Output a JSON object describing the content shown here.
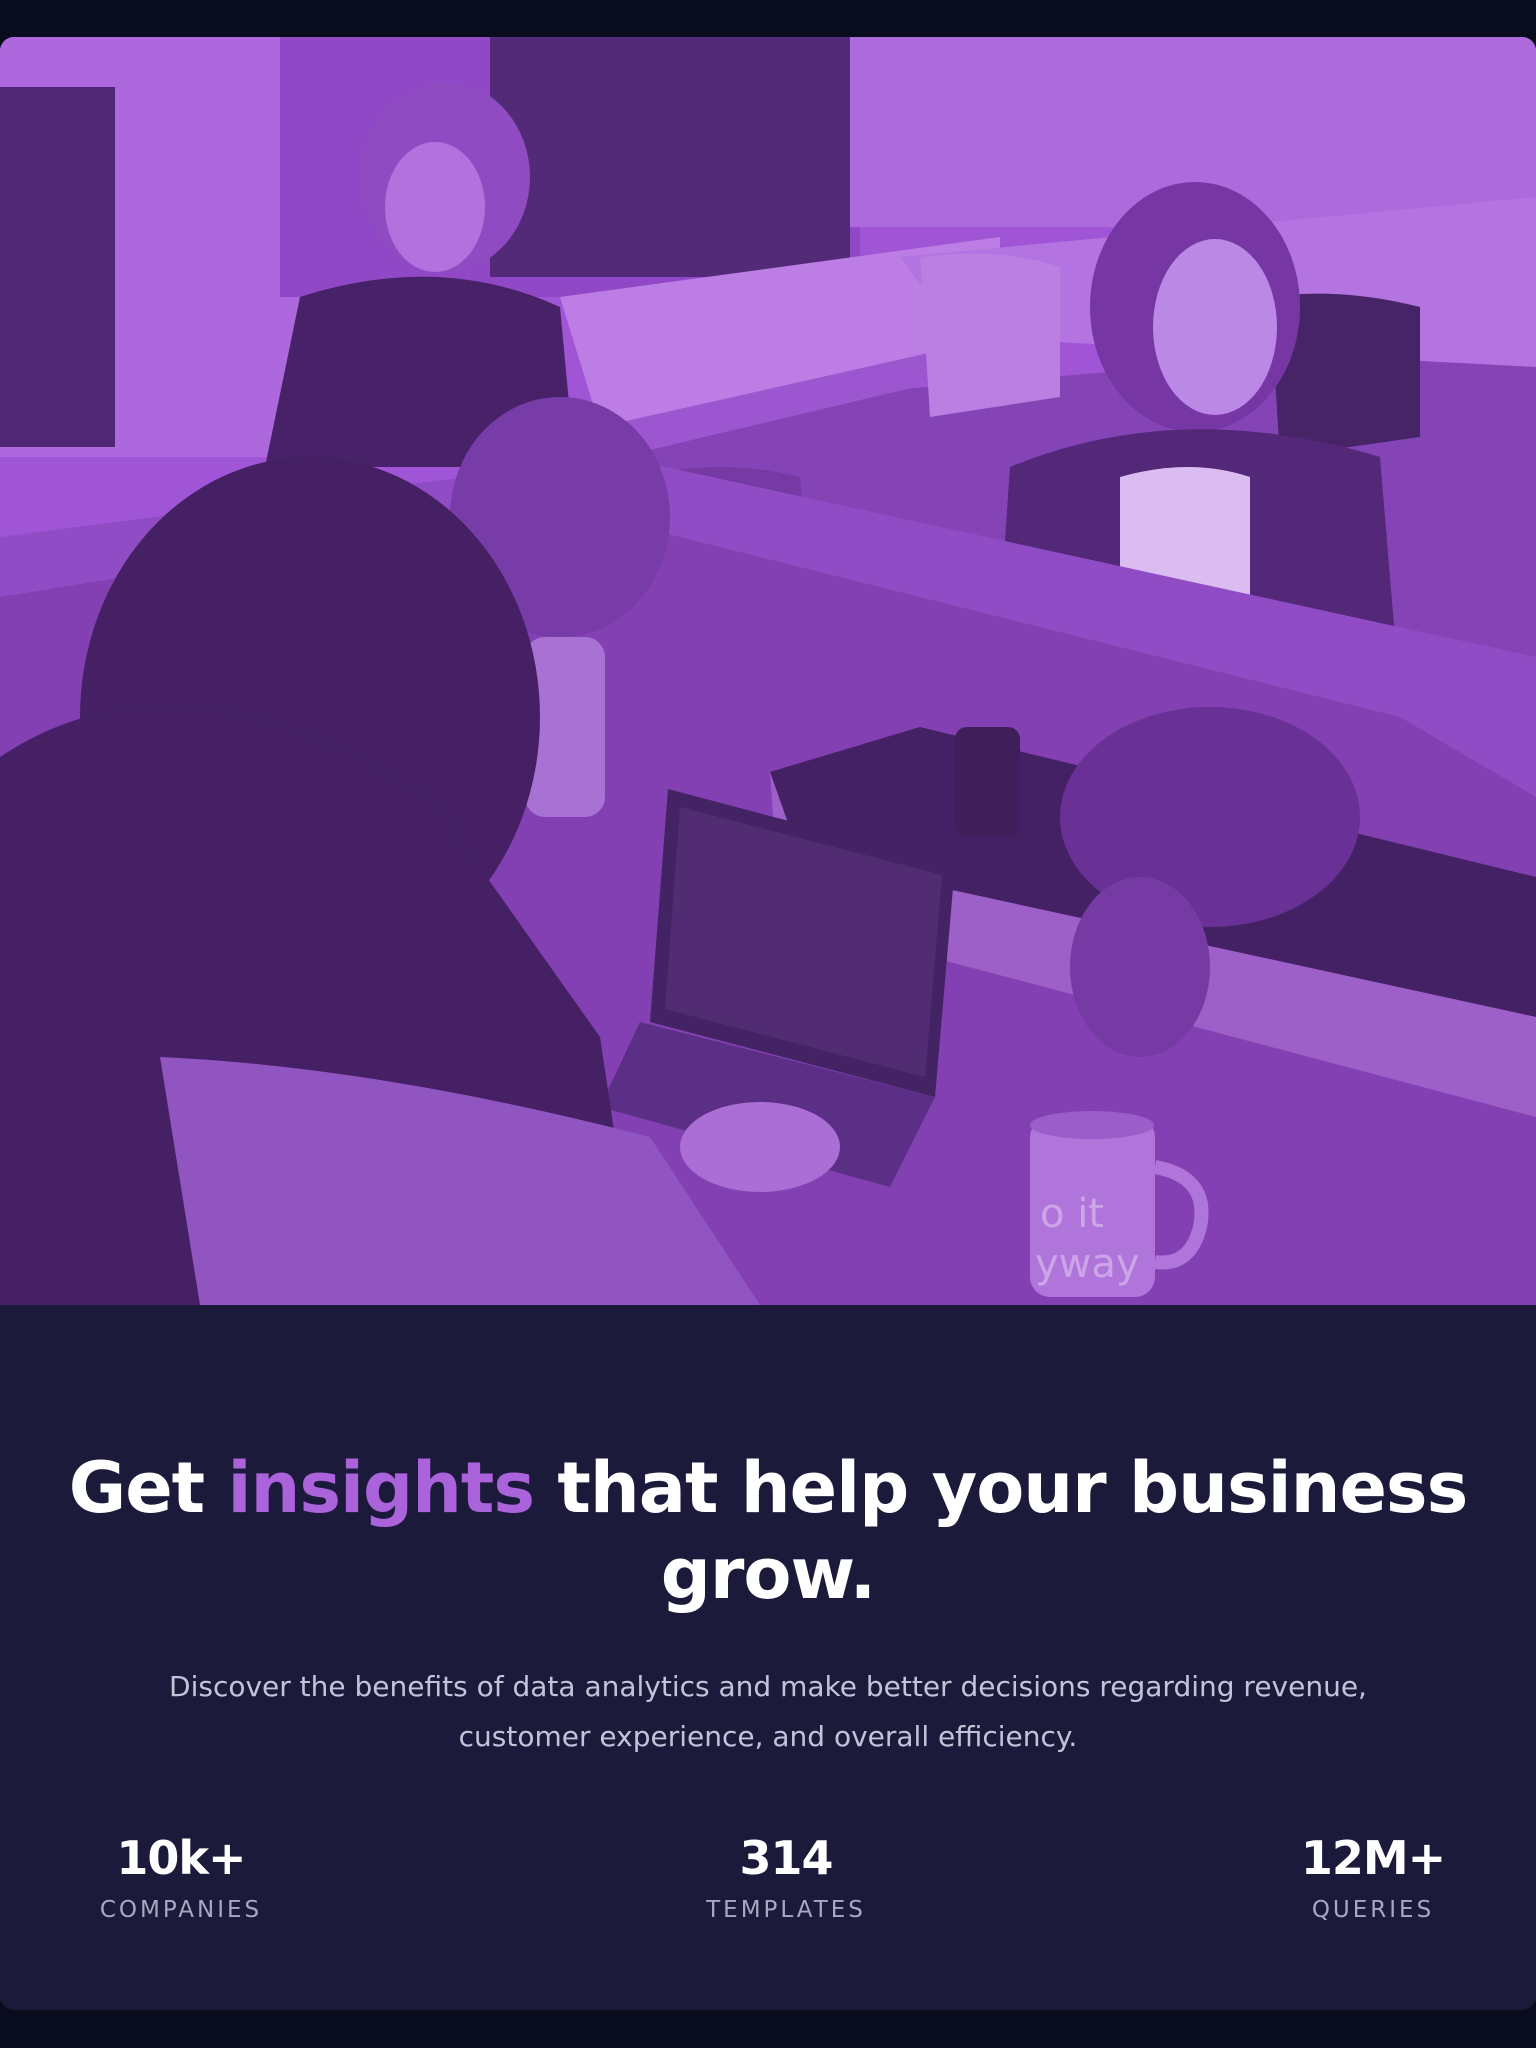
{
  "hero": {
    "photo_description_icon": "office-team-photo",
    "tint_color": "#a155d6",
    "mug_text_line1": "o it",
    "mug_text_line2": "yway"
  },
  "headline": {
    "part1": "Get ",
    "accent": "insights",
    "part2": " that help your business grow.",
    "accent_color": "#ab63db"
  },
  "subtext": "Discover the benefits of data analytics and make better decisions regarding revenue, customer experience, and overall efficiency.",
  "stats": [
    {
      "value": "10k+",
      "label": "COMPANIES"
    },
    {
      "value": "314",
      "label": "TEMPLATES"
    },
    {
      "value": "12M+",
      "label": "QUERIES"
    }
  ],
  "colors": {
    "page_background": "#080c1c",
    "card_background": "#1b1a3a",
    "text_primary": "#ffffff",
    "text_secondary": "#c4c2d9"
  }
}
